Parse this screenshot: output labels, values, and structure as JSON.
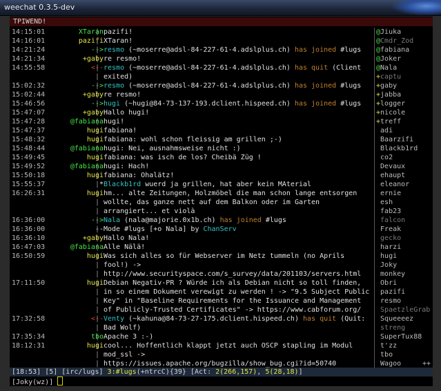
{
  "window_title": "weechat 0.3.5-dev",
  "topic": "TPIWEND!",
  "colors": {
    "green": "#46e646",
    "yellow": "#e6e646",
    "cyan": "#35c2c2",
    "white": "#e0e0e0",
    "gray": "#9a9a9a",
    "brown": "#c08030",
    "red": "#e03c3c"
  },
  "messages": [
    {
      "ts": "14:15:01",
      "nick": "XTaran",
      "nick_c": "green",
      "sep": "|",
      "text": "pazifi!"
    },
    {
      "ts": "14:16:01",
      "nick": "pazifi",
      "nick_c": "yellow",
      "sep": "|",
      "text": "XTaran!"
    },
    {
      "ts": "14:21:24",
      "nick": "-->",
      "nick_c": "green",
      "sep": "|",
      "text": "resmo (~moserre@adsl-84-227-61-4.adslplus.ch) has joined #lugs",
      "kind": "join"
    },
    {
      "ts": "14:21:34",
      "nick": "+gaby",
      "nick_c": "yellow",
      "sep": "|",
      "text": "re resmo!"
    },
    {
      "ts": "14:55:58",
      "nick": "<--",
      "nick_c": "red",
      "sep": "|",
      "text": "resmo (~moserre@adsl-84-227-61-4.adslplus.ch) has quit (Client",
      "kind": "quit"
    },
    {
      "ts": "",
      "nick": "",
      "nick_c": "white",
      "sep": "|",
      "text": "exited)",
      "kind": "cont"
    },
    {
      "ts": "15:02:32",
      "nick": "-->",
      "nick_c": "green",
      "sep": "|",
      "text": "resmo (~moserre@adsl-84-227-61-4.adslplus.ch) has joined #lugs",
      "kind": "join"
    },
    {
      "ts": "15:02:44",
      "nick": "+gaby",
      "nick_c": "yellow",
      "sep": "|",
      "text": "re resmo!"
    },
    {
      "ts": "15:46:56",
      "nick": "-->",
      "nick_c": "green",
      "sep": "|",
      "text": "hugi (~hugi@84-73-137-193.dclient.hispeed.ch) has joined #lugs",
      "kind": "join"
    },
    {
      "ts": "15:47:07",
      "nick": "+gaby",
      "nick_c": "yellow",
      "sep": "|",
      "text": "Hallo hugi!"
    },
    {
      "ts": "15:47:28",
      "nick": "@fabiana",
      "nick_c": "green",
      "sep": "|",
      "text": "hugi!"
    },
    {
      "ts": "15:47:37",
      "nick": "hugi",
      "nick_c": "yellow",
      "sep": "|",
      "text": "fabiana!"
    },
    {
      "ts": "15:48:32",
      "nick": "hugi",
      "nick_c": "yellow",
      "sep": "|",
      "text": "fabiana: wohl schon fleissig am grillen ;-)"
    },
    {
      "ts": "15:48:44",
      "nick": "@fabiana",
      "nick_c": "green",
      "sep": "|",
      "text": "hugi: Nei, ausnahmsweise nicht :)"
    },
    {
      "ts": "15:49:45",
      "nick": "hugi",
      "nick_c": "yellow",
      "sep": "|",
      "text": "fabiana: was isch de los? Cheibä Züg !"
    },
    {
      "ts": "15:49:52",
      "nick": "@fabiana",
      "nick_c": "green",
      "sep": "|",
      "text": "hugi: Hach!"
    },
    {
      "ts": "15:50:18",
      "nick": "hugi",
      "nick_c": "yellow",
      "sep": "|",
      "text": "fabiana: Ohalätz!"
    },
    {
      "ts": "15:55:37",
      "nick": "*",
      "nick_c": "white",
      "sep": "|",
      "text": "Blackb1rd wuerd ja grillen, hat aber kein MAterial",
      "kind": "action",
      "actor": "Blackb1rd"
    },
    {
      "ts": "16:26:31",
      "nick": "hugi",
      "nick_c": "yellow",
      "sep": "|",
      "text": "hm... alte Zeitungen, Holzmöbel die man schon lange entsorgen"
    },
    {
      "ts": "",
      "nick": "",
      "nick_c": "white",
      "sep": "|",
      "text": "wollte, das ganze nett auf dem Balkon oder im Garten",
      "kind": "cont"
    },
    {
      "ts": "",
      "nick": "",
      "nick_c": "white",
      "sep": "|",
      "text": "arrangiert... et violà",
      "kind": "cont"
    },
    {
      "ts": "16:36:00",
      "nick": "-->",
      "nick_c": "green",
      "sep": "|",
      "text": "Nala (nala@majorie.0x1b.ch) has joined #lugs",
      "kind": "join"
    },
    {
      "ts": "16:36:00",
      "nick": "--",
      "nick_c": "white",
      "sep": "|",
      "text": "Mode #lugs [+o Nala] by ChanServ",
      "kind": "mode"
    },
    {
      "ts": "16:36:10",
      "nick": "+gaby",
      "nick_c": "yellow",
      "sep": "|",
      "text": "Hallo Nala!"
    },
    {
      "ts": "16:47:03",
      "nick": "@fabiana",
      "nick_c": "green",
      "sep": "|",
      "text": "Alle Nälä!"
    },
    {
      "ts": "16:50:59",
      "nick": "hugi",
      "nick_c": "yellow",
      "sep": "|",
      "text": "Was sich alles so für Webserver im Netz tummeln (no Aprils"
    },
    {
      "ts": "",
      "nick": "",
      "nick_c": "white",
      "sep": "|",
      "text": "fool!) ->",
      "kind": "cont"
    },
    {
      "ts": "",
      "nick": "",
      "nick_c": "white",
      "sep": "|",
      "text": "http://www.securityspace.com/s_survey/data/201103/servers.html",
      "kind": "cont"
    },
    {
      "ts": "17:11:50",
      "nick": "hugi",
      "nick_c": "yellow",
      "sep": "|",
      "text": "Debian Negativ-PR ? Würde ich als Debian nicht so toll finden,"
    },
    {
      "ts": "",
      "nick": "",
      "nick_c": "white",
      "sep": "|",
      "text": "in so einem Dokument verewigt zu werden ! -> \"9.5 Subject Public",
      "kind": "cont"
    },
    {
      "ts": "",
      "nick": "",
      "nick_c": "white",
      "sep": "|",
      "text": "Key\" in \"Baseline Requirements for the Issuance and Management",
      "kind": "cont"
    },
    {
      "ts": "",
      "nick": "",
      "nick_c": "white",
      "sep": "|",
      "text": "of Publicly-Trusted Certificates\" -> https://www.cabforum.org/",
      "kind": "cont"
    },
    {
      "ts": "17:32:58",
      "nick": "<--",
      "nick_c": "red",
      "sep": "|",
      "text": "Venty (~kahuna@84-73-27-175.dclient.hispeed.ch) has quit (Quit:",
      "kind": "quit"
    },
    {
      "ts": "",
      "nick": "",
      "nick_c": "white",
      "sep": "|",
      "text": "Bad Wolf)",
      "kind": "cont"
    },
    {
      "ts": "17:35:34",
      "nick": "tbo",
      "nick_c": "green",
      "sep": "|",
      "text": "Apache 3 :-)"
    },
    {
      "ts": "18:12:31",
      "nick": "hugi",
      "nick_c": "yellow",
      "sep": "|",
      "text": "cool... Hoffentlich klappt jetzt auch OSCP stapling im Modul"
    },
    {
      "ts": "",
      "nick": "",
      "nick_c": "white",
      "sep": "|",
      "text": "mod_ssl ->",
      "kind": "cont"
    },
    {
      "ts": "",
      "nick": "",
      "nick_c": "white",
      "sep": "|",
      "text": "https://issues.apache.org/bugzilla/show_bug.cgi?id=50740",
      "kind": "cont"
    }
  ],
  "nicklist": [
    {
      "prefix": "@",
      "name": "Jiuka",
      "c": "white"
    },
    {
      "prefix": "@",
      "name": "Cmdr_Zod",
      "c": "gray"
    },
    {
      "prefix": "@",
      "name": "fabiana",
      "c": "white"
    },
    {
      "prefix": "@",
      "name": "Joker",
      "c": "white"
    },
    {
      "prefix": "@",
      "name": "Nala",
      "c": "white"
    },
    {
      "prefix": "+",
      "name": "captu",
      "c": "gray"
    },
    {
      "prefix": "+",
      "name": "gaby",
      "c": "white"
    },
    {
      "prefix": "+",
      "name": "jabba",
      "c": "white"
    },
    {
      "prefix": "+",
      "name": "logger",
      "c": "white"
    },
    {
      "prefix": "+",
      "name": "nicole",
      "c": "white"
    },
    {
      "prefix": "+",
      "name": "treff",
      "c": "white"
    },
    {
      "prefix": " ",
      "name": "adi",
      "c": "white"
    },
    {
      "prefix": " ",
      "name": "Baarzifi",
      "c": "white"
    },
    {
      "prefix": " ",
      "name": "Blackb1rd",
      "c": "white"
    },
    {
      "prefix": " ",
      "name": "co2",
      "c": "white"
    },
    {
      "prefix": " ",
      "name": "Devaux",
      "c": "white"
    },
    {
      "prefix": " ",
      "name": "ehaupt",
      "c": "white"
    },
    {
      "prefix": " ",
      "name": "eleanor",
      "c": "white"
    },
    {
      "prefix": " ",
      "name": "ernie",
      "c": "white"
    },
    {
      "prefix": " ",
      "name": "esh",
      "c": "white"
    },
    {
      "prefix": " ",
      "name": "fab23",
      "c": "white"
    },
    {
      "prefix": " ",
      "name": "falcon",
      "c": "gray"
    },
    {
      "prefix": " ",
      "name": "Freak",
      "c": "white"
    },
    {
      "prefix": " ",
      "name": "gecko",
      "c": "gray"
    },
    {
      "prefix": " ",
      "name": "harzi",
      "c": "white"
    },
    {
      "prefix": " ",
      "name": "hugi",
      "c": "white"
    },
    {
      "prefix": " ",
      "name": "Joky",
      "c": "white"
    },
    {
      "prefix": " ",
      "name": "monkey",
      "c": "white"
    },
    {
      "prefix": " ",
      "name": "Obri",
      "c": "white"
    },
    {
      "prefix": " ",
      "name": "pazifi",
      "c": "white"
    },
    {
      "prefix": " ",
      "name": "resmo",
      "c": "white"
    },
    {
      "prefix": " ",
      "name": "SpaetzleGrab",
      "c": "gray"
    },
    {
      "prefix": " ",
      "name": "Squeeeez",
      "c": "white"
    },
    {
      "prefix": " ",
      "name": "streng",
      "c": "gray"
    },
    {
      "prefix": " ",
      "name": "SuperTux88",
      "c": "white"
    },
    {
      "prefix": " ",
      "name": "t'zz",
      "c": "white"
    },
    {
      "prefix": " ",
      "name": "tbo",
      "c": "white"
    },
    {
      "prefix": " ",
      "name": "Wagoo",
      "c": "white"
    }
  ],
  "nicklist_more": "++",
  "status": {
    "time": "[18:53]",
    "buf_count": "[5]",
    "server": "[irc/lugs]",
    "buffer_num": "3",
    "channel": ":#lugs",
    "modes": "(+ntrcC)",
    "nick_count": "{39}",
    "act_label": "[Act: ",
    "act_a": "2",
    "act_a_detail": "(266,157)",
    "act_sep": ", ",
    "act_b": "5",
    "act_b_detail": "(28,18)",
    "act_end": "]"
  },
  "input_prompt": "[Joky(wz)]"
}
